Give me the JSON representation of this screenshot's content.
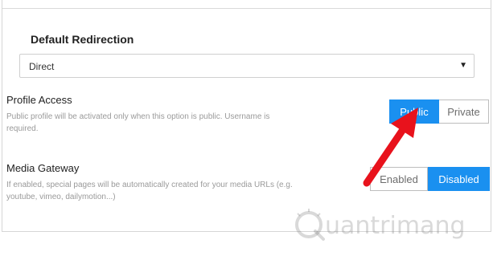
{
  "default_redirection": {
    "label": "Default Redirection",
    "selected": "Direct",
    "caret_icon": "caret-down-icon"
  },
  "profile_access": {
    "title": "Profile Access",
    "description": "Public profile will be activated only when this option is public. Username is required.",
    "options": [
      "Public",
      "Private"
    ],
    "selected": "Public"
  },
  "media_gateway": {
    "title": "Media Gateway",
    "description": "If enabled, special pages will be automatically created for your media URLs (e.g. youtube, vimeo, dailymotion...)",
    "options": [
      "Enabled",
      "Disabled"
    ],
    "selected": "Disabled"
  },
  "watermark": {
    "text": "uantrimang",
    "logo_icon": "quantrimang-logo-icon"
  },
  "annotation": {
    "arrow_icon": "red-arrow-icon",
    "color": "#e8121c"
  },
  "colors": {
    "accent": "#1a90f0",
    "inactive_text": "#6d6d6d"
  }
}
